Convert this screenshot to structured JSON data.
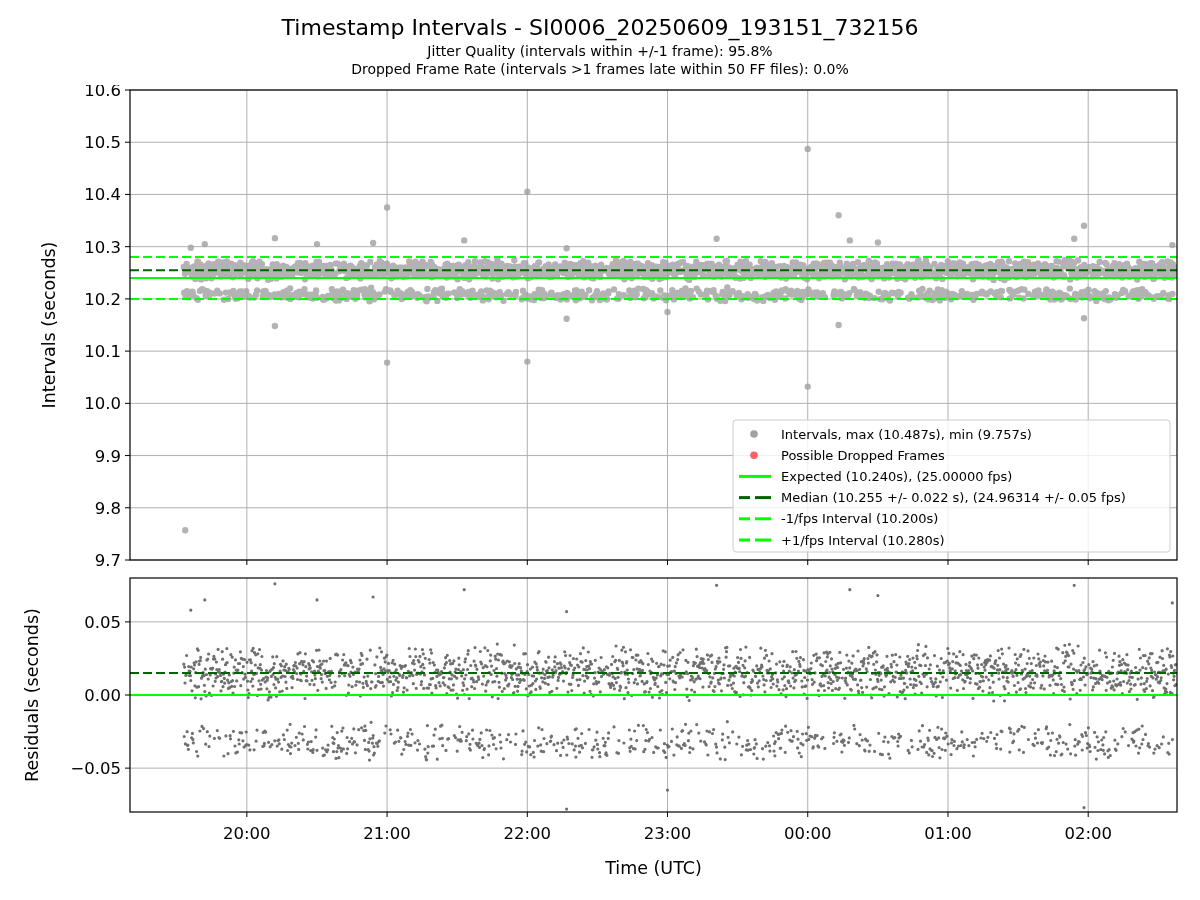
{
  "figure": {
    "title": "Timestamp Intervals - SI0006_20250609_193151_732156",
    "subtitles": [
      "Jitter Quality (intervals within +/-1 frame): 95.8%",
      "Dropped Frame Rate (intervals >1 frames late within 50 FF files): 0.0%"
    ]
  },
  "intervals_plot": {
    "legend_markers": [
      {
        "color": "#a0a0a0",
        "label": "Intervals, max (10.487s), min (9.757s)"
      },
      {
        "color": "#ff6060",
        "label": "Possible Dropped Frames"
      }
    ],
    "chart_data": {
      "type": "line",
      "ylabel": "Intervals (seconds)",
      "grid": true,
      "x": [
        "2025-06-09T19:10",
        "2025-06-10T02:38"
      ],
      "xlim": [
        "2025-06-09T19:10",
        "2025-06-10T02:38"
      ],
      "ylim": [
        9.7,
        10.6
      ],
      "legend": "lower right",
      "yticks": [
        {
          "value": 9.7,
          "label": "9.7"
        },
        {
          "value": 9.8,
          "label": "9.8"
        },
        {
          "value": 9.9,
          "label": "9.9"
        },
        {
          "value": 10.0,
          "label": "10.0"
        },
        {
          "value": 10.1,
          "label": "10.1"
        },
        {
          "value": 10.2,
          "label": "10.2"
        },
        {
          "value": 10.3,
          "label": "10.3"
        },
        {
          "value": 10.4,
          "label": "10.4"
        },
        {
          "value": 10.5,
          "label": "10.5"
        },
        {
          "value": 10.6,
          "label": "10.6"
        }
      ],
      "series": [
        {
          "name": "Expected (10.240s), (25.00000 fps)",
          "color": "#00ff00",
          "line_style": "solid",
          "values": [
            10.24,
            10.24
          ]
        },
        {
          "name": "Median (10.255 +/- 0.022 s), (24.96314 +/- 0.05 fps)",
          "color": "#006400",
          "line_style": "dashed",
          "values": [
            10.255,
            10.255
          ]
        },
        {
          "name": "-1/fps Interval (10.200s)",
          "color": "#00ff00",
          "line_style": "dashed",
          "values": [
            10.2,
            10.2
          ]
        },
        {
          "name": "+1/fps Interval (10.280s)",
          "color": "#00ff00",
          "line_style": "dashed",
          "values": [
            10.28,
            10.28
          ]
        }
      ]
    }
  },
  "residuals_plot": {
    "chart_data": {
      "type": "line",
      "xlabel": "Time (UTC)",
      "ylabel": "Residuals (seconds)",
      "grid": true,
      "x": [
        "2025-06-09T19:10",
        "2025-06-10T02:38"
      ],
      "xlim": [
        "2025-06-09T19:10",
        "2025-06-10T02:38"
      ],
      "ylim": [
        -0.08,
        0.08
      ],
      "yticks": [
        {
          "value": -0.05,
          "label": "−0.05"
        },
        {
          "value": 0,
          "label": "0.00"
        },
        {
          "value": 0.05,
          "label": "0.05"
        }
      ],
      "xticks": [
        {
          "value": "2025-06-09T20:00",
          "label": "20:00"
        },
        {
          "value": "2025-06-09T21:00",
          "label": "21:00"
        },
        {
          "value": "2025-06-09T22:00",
          "label": "22:00"
        },
        {
          "value": "2025-06-09T23:00",
          "label": "23:00"
        },
        {
          "value": "2025-06-10T00:00",
          "label": "00:00"
        },
        {
          "value": "2025-06-10T01:00",
          "label": "01:00"
        },
        {
          "value": "2025-06-10T02:00",
          "label": "02:00"
        }
      ],
      "series": [
        {
          "color": "#00ff00",
          "line_style": "solid",
          "values": [
            0,
            0
          ]
        },
        {
          "color": "#006400",
          "line_style": "dashed",
          "values": [
            0.015,
            0.015
          ]
        }
      ]
    }
  }
}
